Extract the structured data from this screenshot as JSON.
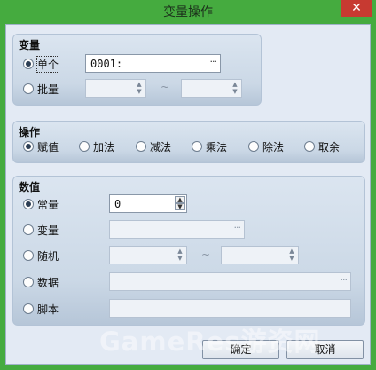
{
  "window": {
    "title": "变量操作",
    "close_glyph": "✕"
  },
  "variable_group": {
    "title": "变量",
    "single": {
      "label": "单个",
      "value": "0001:",
      "ellipsis": "···"
    },
    "batch": {
      "label": "批量",
      "separator": "~"
    }
  },
  "operation_group": {
    "title": "操作",
    "options": [
      "赋值",
      "加法",
      "减法",
      "乘法",
      "除法",
      "取余"
    ]
  },
  "value_group": {
    "title": "数值",
    "constant": {
      "label": "常量",
      "value": "0"
    },
    "variable": {
      "label": "变量",
      "ellipsis": "···"
    },
    "random": {
      "label": "随机",
      "separator": "~"
    },
    "data": {
      "label": "数据",
      "ellipsis": "···"
    },
    "script": {
      "label": "脚本"
    }
  },
  "buttons": {
    "ok": "确定",
    "cancel": "取消"
  },
  "spin_glyphs": {
    "up": "▲",
    "down": "▼"
  },
  "watermark": "GameRes游资网"
}
